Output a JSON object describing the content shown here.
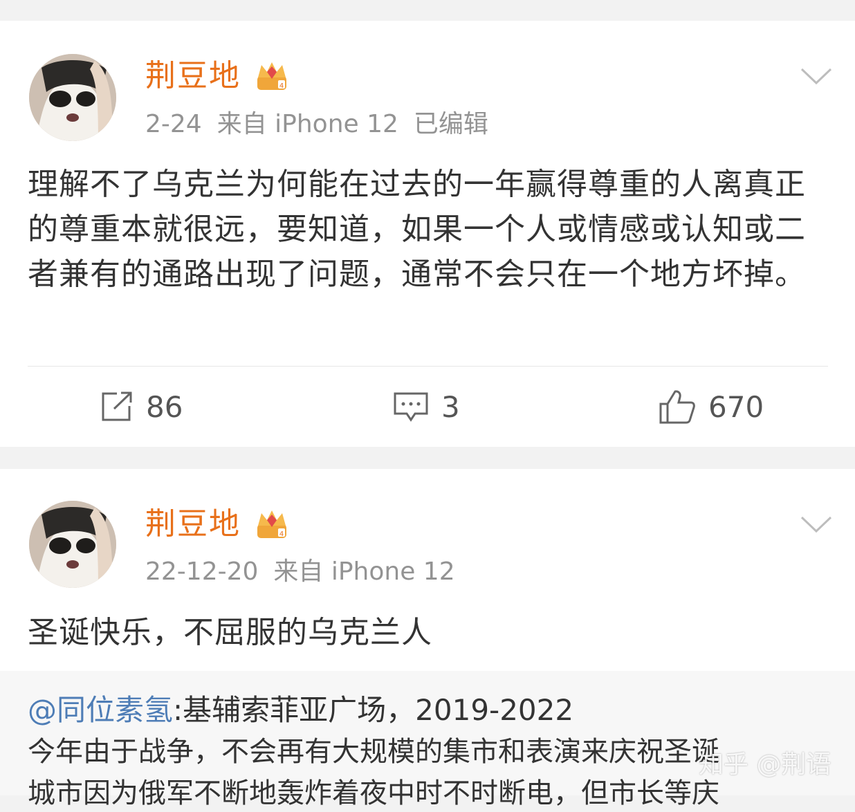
{
  "posts": [
    {
      "username": "荆豆地",
      "date": "2-24",
      "source": "来自 iPhone 12",
      "edited": "已编辑",
      "text": "理解不了乌克兰为何能在过去的一年赢得尊重的人离真正的尊重本就很远，要知道，如果一个人或情感或认知或二者兼有的通路出现了问题，通常不会只在一个地方坏掉。",
      "reposts": "86",
      "comments": "3",
      "likes": "670"
    },
    {
      "username": "荆豆地",
      "date": "22-12-20",
      "source": "来自 iPhone 12",
      "text": "圣诞快乐，不屈服的乌克兰人",
      "repost": {
        "mention": "@同位素氢",
        "line1_rest": ":基辅索菲亚广场，2019-2022",
        "line2": "今年由于战争，不会再有大规模的集市和表演来庆祝圣诞",
        "line3": "城市因为俄军不断地轰炸着夜中时不时断电，但市长等庆"
      }
    }
  ],
  "watermark": "知乎 @荆语",
  "colors": {
    "username": "#e8701a",
    "meta": "#939393",
    "mention": "#4e7db6",
    "page_bg": "#f2f2f2"
  },
  "icons": {
    "badge": "crown-badge-icon",
    "menu": "chevron-down-icon",
    "repost": "repost-icon",
    "comment": "comment-icon",
    "like": "thumbs-up-icon"
  }
}
